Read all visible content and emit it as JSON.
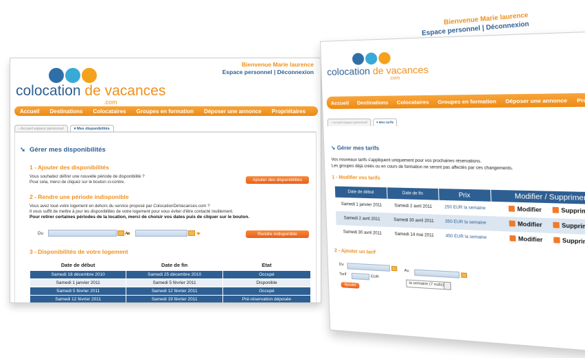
{
  "left": {
    "logo": {
      "brand_main": "colocation",
      "brand_de": "de vacances",
      "brand_com": ".com"
    },
    "welcome": {
      "hello": "Bienvenue Marie laurence",
      "links": "Espace personnel  |  Déconnexion"
    },
    "nav": [
      "Accueil",
      "Destinations",
      "Colocataires",
      "Groupes en formation",
      "Déposer une annonce",
      "Propriétaires"
    ],
    "subtabs": [
      "‹ Accueil espace personnel",
      "▾ Mes disponibilités"
    ],
    "page_title": "Gérer mes disponibilités",
    "section1": {
      "title": "1 - Ajouter des disponibilités",
      "line1": "Vous souhaitez définir une nouvelle période de disponibilité ?",
      "line2": "Pour cela, merci de cliquez sur le bouton ci-contre.",
      "button": "Ajouter des disponibilités"
    },
    "section2": {
      "title": "2 - Rendre une période indisponible",
      "line1": "Vous avez loué votre logement en dehors du service proposé par ColocationDeVacances.com ?",
      "line2": "Il vous suffit de mettre à jour les disponibilités de votre logement pour vous éviter d'être contacté inutilement.",
      "line3": "Pour retirer certaines périodes de la location, merci de choisir vos dates puis de cliquer sur le bouton.",
      "du": "Du",
      "au": "Au",
      "button": "Rendre indisponible"
    },
    "section3": {
      "title": "3 - Disponibilités de votre logement",
      "headers": [
        "Date de début",
        "Date de fin",
        "Etat"
      ],
      "rows": [
        [
          "Samedi 18 décembre 2010",
          "Samedi 25 décembre 2010",
          "Occupé"
        ],
        [
          "Samedi 1 janvier 2011",
          "Samedi 5 février 2011",
          "Disponible"
        ],
        [
          "Samedi 5 février 2011",
          "Samedi 12 février 2011",
          "Occupé"
        ],
        [
          "Samedi 12 février 2011",
          "Samedi 19 février 2011",
          "Pré-réservation déposée"
        ]
      ]
    }
  },
  "right": {
    "welcome": {
      "hello": "Bienvenue Marie laurence",
      "links": "Espace personnel  |  Déconnexion"
    },
    "logo": {
      "brand_main": "colocation",
      "brand_de": "de vacances",
      "brand_com": ".com"
    },
    "nav": [
      "Accueil",
      "Destinations",
      "Colocataires",
      "Groupes en formation",
      "Déposer une annonce",
      "Propriétaires"
    ],
    "subtabs": [
      "‹ Accueil espace personnel",
      "▾ Mes tarifs"
    ],
    "page_title": "Gérer mes tarifs",
    "intro1": "Vos nouveaux tarifs s'appliquent uniquement pour vos prochaines réservations.",
    "intro2": "Les groupes déjà créés ou en cours de formation ne seront pas affectés par ces changements.",
    "section1_title": "1 - Modifier vos tarifs",
    "table": {
      "headers": [
        "Date de début",
        "Date de fin",
        "Prix",
        "Modifier / Supprimer"
      ],
      "rows": [
        [
          "Samedi 1 janvier 2011",
          "Samedi 2 avril 2011",
          "250 EUR la semaine"
        ],
        [
          "Samedi 2 avril 2011",
          "Samedi 30 avril 2011",
          "350 EUR la semaine"
        ],
        [
          "Samedi 30 avril 2011",
          "Samedi 14 mai 2011",
          "450 EUR la semaine"
        ]
      ],
      "modify": "Modifier",
      "delete": "Supprimer"
    },
    "section2_title": "2 - Ajouter un tarif",
    "form": {
      "du": "Du",
      "au": "Au",
      "tarif": "Tarif",
      "eur": "EUR",
      "period": "la semaine (7 nuits)",
      "button": "Ajouter"
    }
  }
}
